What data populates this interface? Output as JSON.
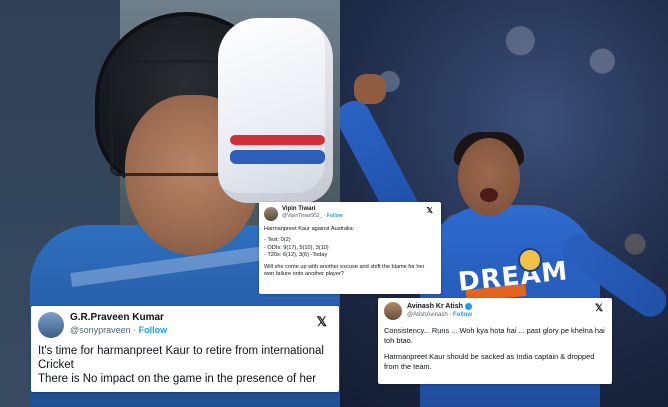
{
  "tweets": [
    {
      "name": "G.R.Praveen Kumar",
      "handle": "@sonypraveen",
      "follow": "Follow",
      "body": [
        "It's time for harmanpreet Kaur to retire from international Cricket",
        "There is No impact on the game in the presence of her"
      ],
      "icon": "x-logo-icon"
    },
    {
      "name": "Vipin Tiwari",
      "handle": "@VipinTiwari952_",
      "follow": "Follow",
      "intro": "Harmanpreet Kaur against Australia:",
      "lines": [
        "- Test: 0(2)",
        "- ODIs: 9(17), 5(10), 3(10)",
        "- T20s: 6(12), 3(6) -Today"
      ],
      "question": "Will she come up with another excuse and shift the blame for her own failure onto another player?",
      "icon": "x-logo-icon"
    },
    {
      "name": "Avinash Kr Atish",
      "handle": "@AtishAvinash",
      "follow": "Follow",
      "body": [
        "Consistency... Runs ... Woh kya hota hai ... past glory pe khelna hai toh btao.",
        "Harmanpreet Kaur should be sacked as India captain & dropped from the team."
      ],
      "icon": "x-logo-icon"
    }
  ],
  "photos": {
    "right_jersey_text": "DREAM"
  },
  "colors": {
    "follow": "#1d9bf0",
    "jersey": "#2458b3"
  }
}
